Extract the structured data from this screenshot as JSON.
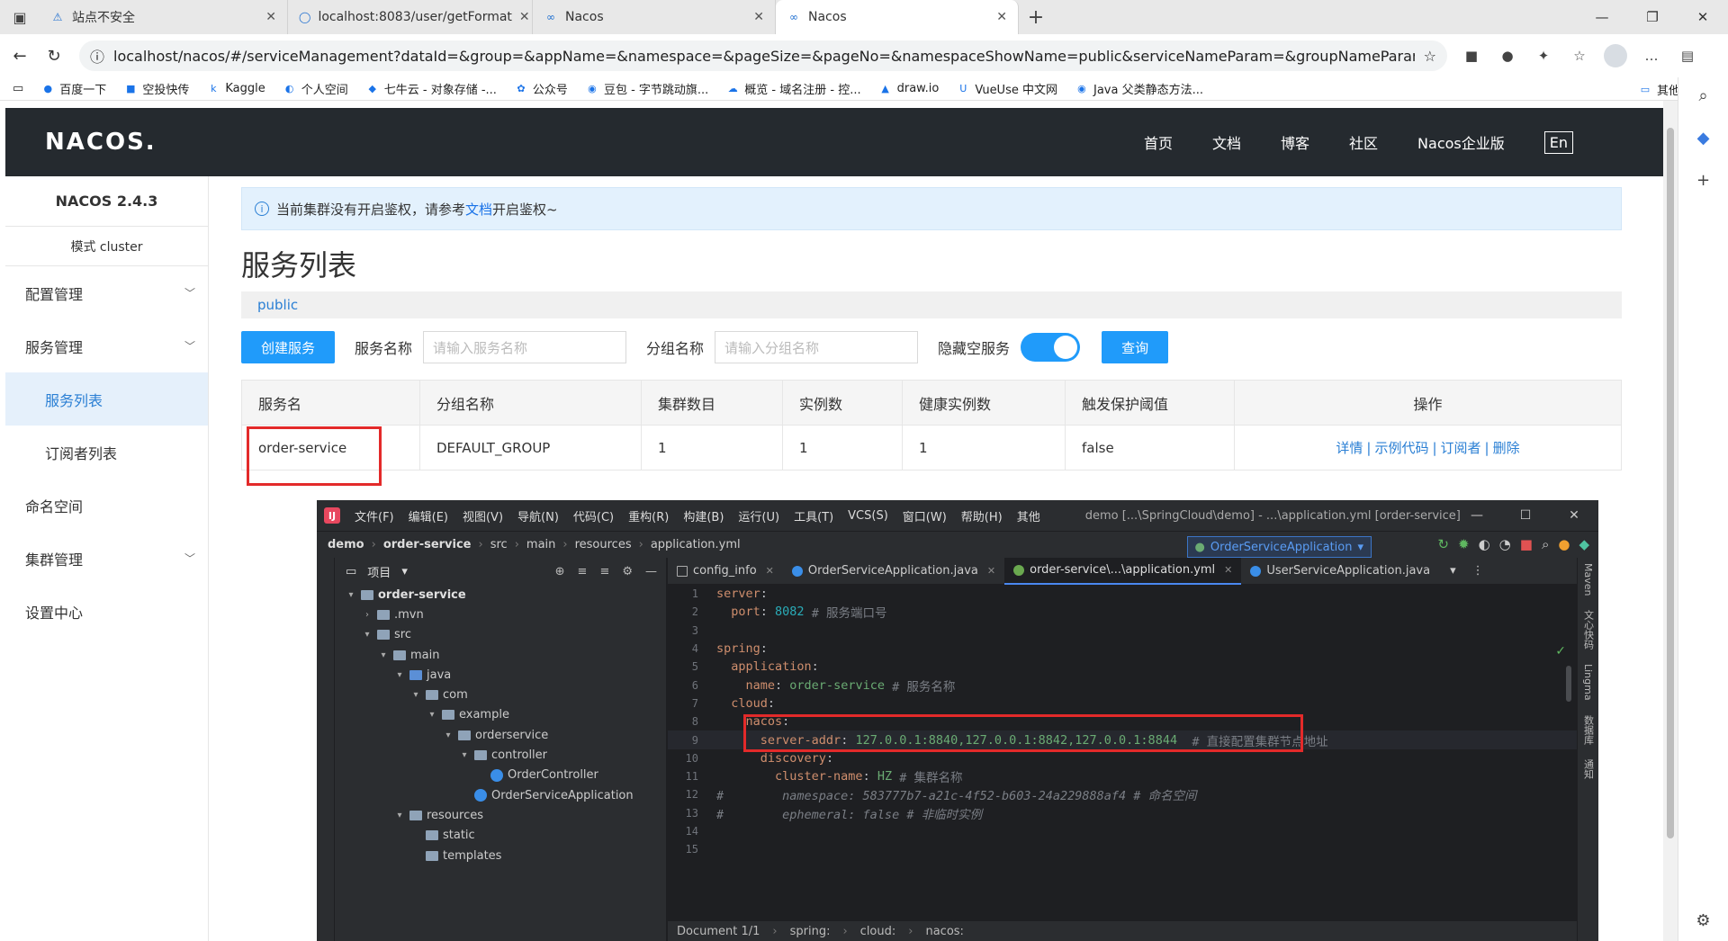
{
  "browser": {
    "tabs": [
      {
        "title": "站点不安全",
        "icon": "warning-icon"
      },
      {
        "title": "localhost:8083/user/getFormat",
        "icon": "globe-icon"
      },
      {
        "title": "Nacos",
        "icon": "nacos-icon"
      },
      {
        "title": "Nacos",
        "icon": "nacos-icon"
      }
    ],
    "active_tab": 3,
    "url": "localhost/nacos/#/serviceManagement?dataId=&group=&appName=&namespace=&pageSize=&pageNo=&namespaceShowName=public&serviceNameParam=&groupNameParam=",
    "bookmarks": [
      "百度一下",
      "空投快传",
      "Kaggle",
      "个人空间",
      "七牛云 - 对象存储 -...",
      "公众号",
      "豆包 - 字节跳动旗...",
      "概览 - 域名注册 - 控...",
      "draw.io",
      "VueUse 中文网",
      "Java 父类静态方法..."
    ],
    "bookmarks_other": "其他收藏夹"
  },
  "nacos": {
    "logo": "NACOS.",
    "menu": [
      "首页",
      "文档",
      "博客",
      "社区",
      "Nacos企业版"
    ],
    "lang": "En",
    "version": "NACOS 2.4.3",
    "mode": "模式 cluster",
    "side": [
      {
        "label": "配置管理",
        "chevron": true
      },
      {
        "label": "服务管理",
        "chevron": true
      },
      {
        "label": "服务列表",
        "sub": true,
        "active": true
      },
      {
        "label": "订阅者列表",
        "sub": true
      },
      {
        "label": "命名空间"
      },
      {
        "label": "集群管理",
        "chevron": true
      },
      {
        "label": "设置中心"
      }
    ],
    "notice": {
      "before": "当前集群没有开启鉴权，请参考",
      "link": "文档",
      "after": "开启鉴权~"
    },
    "page_title": "服务列表",
    "namespace": "public",
    "filter": {
      "create_btn": "创建服务",
      "service_label": "服务名称",
      "service_placeholder": "请输入服务名称",
      "group_label": "分组名称",
      "group_placeholder": "请输入分组名称",
      "hide_empty_label": "隐藏空服务",
      "hide_empty_on": true,
      "query_btn": "查询"
    },
    "table": {
      "headers": [
        "服务名",
        "分组名称",
        "集群数目",
        "实例数",
        "健康实例数",
        "触发保护阈值",
        "操作"
      ],
      "rows": [
        {
          "name": "order-service",
          "group": "DEFAULT_GROUP",
          "clusters": "1",
          "instances": "1",
          "healthy": "1",
          "threshold": "false"
        }
      ],
      "ops": [
        "详情",
        "示例代码",
        "订阅者",
        "删除"
      ]
    }
  },
  "ide": {
    "menu": [
      "文件(F)",
      "编辑(E)",
      "视图(V)",
      "导航(N)",
      "代码(C)",
      "重构(R)",
      "构建(B)",
      "运行(U)",
      "工具(T)",
      "VCS(S)",
      "窗口(W)",
      "帮助(H)",
      "其他"
    ],
    "title": "demo [...\\SpringCloud\\demo] - ...\\application.yml [order-service]",
    "breadcrumb": [
      "demo",
      "order-service",
      "src",
      "main",
      "resources",
      "application.yml"
    ],
    "run_config": "OrderServiceApplication",
    "project_label": "项目",
    "tree": [
      {
        "label": "order-service",
        "depth": 0,
        "open": true,
        "type": "module",
        "bold": true
      },
      {
        "label": ".mvn",
        "depth": 1,
        "open": false,
        "type": "folder"
      },
      {
        "label": "src",
        "depth": 1,
        "open": true,
        "type": "folder"
      },
      {
        "label": "main",
        "depth": 2,
        "open": true,
        "type": "folder"
      },
      {
        "label": "java",
        "depth": 3,
        "open": true,
        "type": "folder-blue"
      },
      {
        "label": "com",
        "depth": 4,
        "open": true,
        "type": "folder"
      },
      {
        "label": "example",
        "depth": 5,
        "open": true,
        "type": "folder"
      },
      {
        "label": "orderservice",
        "depth": 6,
        "open": true,
        "type": "folder"
      },
      {
        "label": "controller",
        "depth": 7,
        "open": true,
        "type": "folder"
      },
      {
        "label": "OrderController",
        "depth": 8,
        "type": "class"
      },
      {
        "label": "OrderServiceApplication",
        "depth": 7,
        "type": "class"
      },
      {
        "label": "resources",
        "depth": 3,
        "open": true,
        "type": "folder"
      },
      {
        "label": "static",
        "depth": 4,
        "type": "folder"
      },
      {
        "label": "templates",
        "depth": 4,
        "type": "folder"
      }
    ],
    "tabs": [
      {
        "label": "config_info",
        "icon": "grid"
      },
      {
        "label": "OrderServiceApplication.java",
        "icon": "class"
      },
      {
        "label": "order-service\\...\\application.yml",
        "icon": "yml",
        "active": true
      },
      {
        "label": "UserServiceApplication.java",
        "icon": "class"
      }
    ],
    "code": [
      {
        "n": "1",
        "parts": [
          [
            "k",
            "server"
          ],
          [
            "p",
            ":"
          ]
        ]
      },
      {
        "n": "2",
        "parts": [
          [
            "p",
            "  "
          ],
          [
            "k",
            "port"
          ],
          [
            "p",
            ": "
          ],
          [
            "n",
            "8082"
          ],
          [
            "c",
            " # 服务端口号"
          ]
        ]
      },
      {
        "n": "3",
        "parts": []
      },
      {
        "n": "4",
        "parts": [
          [
            "k",
            "spring"
          ],
          [
            "p",
            ":"
          ]
        ]
      },
      {
        "n": "5",
        "parts": [
          [
            "p",
            "  "
          ],
          [
            "k",
            "application"
          ],
          [
            "p",
            ":"
          ]
        ]
      },
      {
        "n": "6",
        "parts": [
          [
            "p",
            "    "
          ],
          [
            "k",
            "name"
          ],
          [
            "p",
            ": "
          ],
          [
            "v",
            "order-service"
          ],
          [
            "c",
            " # 服务名称"
          ]
        ]
      },
      {
        "n": "7",
        "parts": [
          [
            "p",
            "  "
          ],
          [
            "k",
            "cloud"
          ],
          [
            "p",
            ":"
          ]
        ]
      },
      {
        "n": "8",
        "parts": [
          [
            "p",
            "    "
          ],
          [
            "k",
            "nacos"
          ],
          [
            "p",
            ":"
          ]
        ]
      },
      {
        "n": "9",
        "parts": [
          [
            "p",
            "      "
          ],
          [
            "k",
            "server-addr"
          ],
          [
            "p",
            ": "
          ],
          [
            "v",
            "127.0.0.1:8840,127.0.0.1:8842,127.0.0.1:8844"
          ],
          [
            "c",
            "  # 直接配置集群节点地址"
          ]
        ],
        "hl": true
      },
      {
        "n": "10",
        "parts": [
          [
            "p",
            "      "
          ],
          [
            "k",
            "discovery"
          ],
          [
            "p",
            ":"
          ]
        ]
      },
      {
        "n": "11",
        "parts": [
          [
            "p",
            "        "
          ],
          [
            "k",
            "cluster-name"
          ],
          [
            "p",
            ": "
          ],
          [
            "v",
            "HZ"
          ],
          [
            "c",
            " # 集群名称"
          ]
        ]
      },
      {
        "n": "12",
        "parts": [
          [
            "cm",
            "#        namespace: 583777b7-a21c-4f52-b603-24a229888af4 # 命名空间"
          ]
        ]
      },
      {
        "n": "13",
        "parts": [
          [
            "cm",
            "#        ephemeral: false # 非临时实例"
          ]
        ]
      },
      {
        "n": "14",
        "parts": []
      },
      {
        "n": "15",
        "parts": []
      }
    ],
    "status": [
      "Document 1/1",
      "spring:",
      "cloud:",
      "nacos:"
    ],
    "right_tools": [
      "Maven",
      "文心快码",
      "Lingma",
      "数据库",
      "通知"
    ]
  }
}
